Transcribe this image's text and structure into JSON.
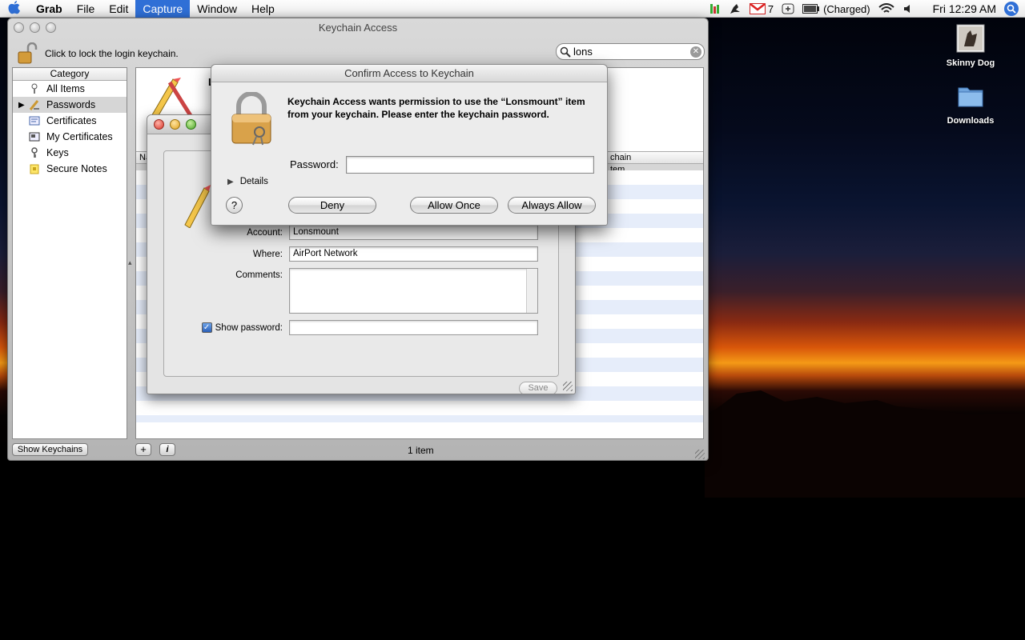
{
  "menubar": {
    "app": "Grab",
    "items": [
      "File",
      "Edit",
      "Capture",
      "Window",
      "Help"
    ],
    "active": "Capture",
    "gmail_count": "7",
    "battery": "(Charged)",
    "clock": "Fri 12:29 AM"
  },
  "desktop": {
    "icons": [
      {
        "label": "Skinny Dog",
        "icon": "photo-icon"
      },
      {
        "label": "Downloads",
        "icon": "folder-icon"
      }
    ]
  },
  "keychain": {
    "title": "Keychain Access",
    "lock_text": "Click to lock the login keychain.",
    "search_value": "lons",
    "category_header": "Category",
    "categories": [
      {
        "label": "All Items",
        "icon": "all-items-icon"
      },
      {
        "label": "Passwords",
        "icon": "passwords-icon",
        "selected": true
      },
      {
        "label": "Certificates",
        "icon": "certificates-icon"
      },
      {
        "label": "My Certificates",
        "icon": "my-certificates-icon"
      },
      {
        "label": "Keys",
        "icon": "keys-icon"
      },
      {
        "label": "Secure Notes",
        "icon": "secure-notes-icon"
      }
    ],
    "column_name_partial": "Na",
    "column_keychain_partial": "chain",
    "row_keychain_partial": "tem",
    "show_keychains": "Show Keychains",
    "add_label": "+",
    "info_label": "i",
    "count": "1 item"
  },
  "detail": {
    "account_label": "Account:",
    "account_value": "Lonsmount",
    "where_label": "Where:",
    "where_value": "AirPort Network",
    "comments_label": "Comments:",
    "show_password_label": "Show password:",
    "show_password_checked": true,
    "save_label": "Save"
  },
  "dialog": {
    "title": "Confirm Access to Keychain",
    "message": "Keychain Access wants permission to use the “Lonsmount” item from your keychain. Please enter the keychain password.",
    "password_label": "Password:",
    "password_value": "",
    "details_label": "Details",
    "help_label": "?",
    "deny_label": "Deny",
    "allow_once_label": "Allow Once",
    "always_allow_label": "Always Allow"
  },
  "colors": {
    "accent": "#2f6fd6",
    "selection": "#d6d6d6",
    "stripe": "#e6edfa"
  }
}
